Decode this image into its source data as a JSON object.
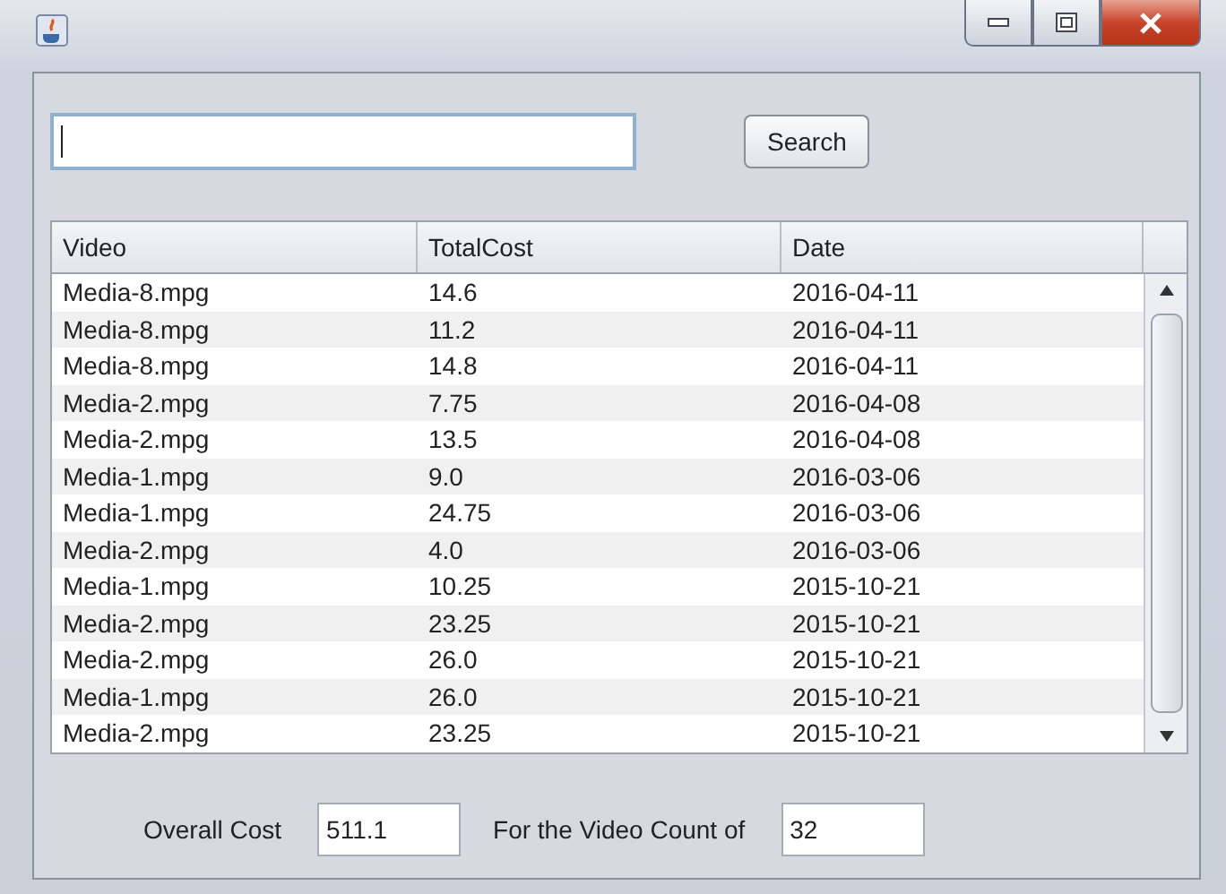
{
  "search": {
    "button": "Search"
  },
  "table": {
    "columns": [
      "Video",
      "TotalCost",
      "Date"
    ],
    "rows": [
      [
        "Media-8.mpg",
        "14.6",
        "2016-04-11"
      ],
      [
        "Media-8.mpg",
        "11.2",
        "2016-04-11"
      ],
      [
        "Media-8.mpg",
        "14.8",
        "2016-04-11"
      ],
      [
        "Media-2.mpg",
        "7.75",
        "2016-04-08"
      ],
      [
        "Media-2.mpg",
        "13.5",
        "2016-04-08"
      ],
      [
        "Media-1.mpg",
        "9.0",
        "2016-03-06"
      ],
      [
        "Media-1.mpg",
        "24.75",
        "2016-03-06"
      ],
      [
        "Media-2.mpg",
        "4.0",
        "2016-03-06"
      ],
      [
        "Media-1.mpg",
        "10.25",
        "2015-10-21"
      ],
      [
        "Media-2.mpg",
        "23.25",
        "2015-10-21"
      ],
      [
        "Media-2.mpg",
        "26.0",
        "2015-10-21"
      ],
      [
        "Media-1.mpg",
        "26.0",
        "2015-10-21"
      ],
      [
        "Media-2.mpg",
        "23.25",
        "2015-10-21"
      ]
    ]
  },
  "footer": {
    "fields": [
      {
        "label": "Overall Cost",
        "value": "511.1"
      },
      {
        "label": "For the Video Count of",
        "value": "32"
      }
    ]
  }
}
